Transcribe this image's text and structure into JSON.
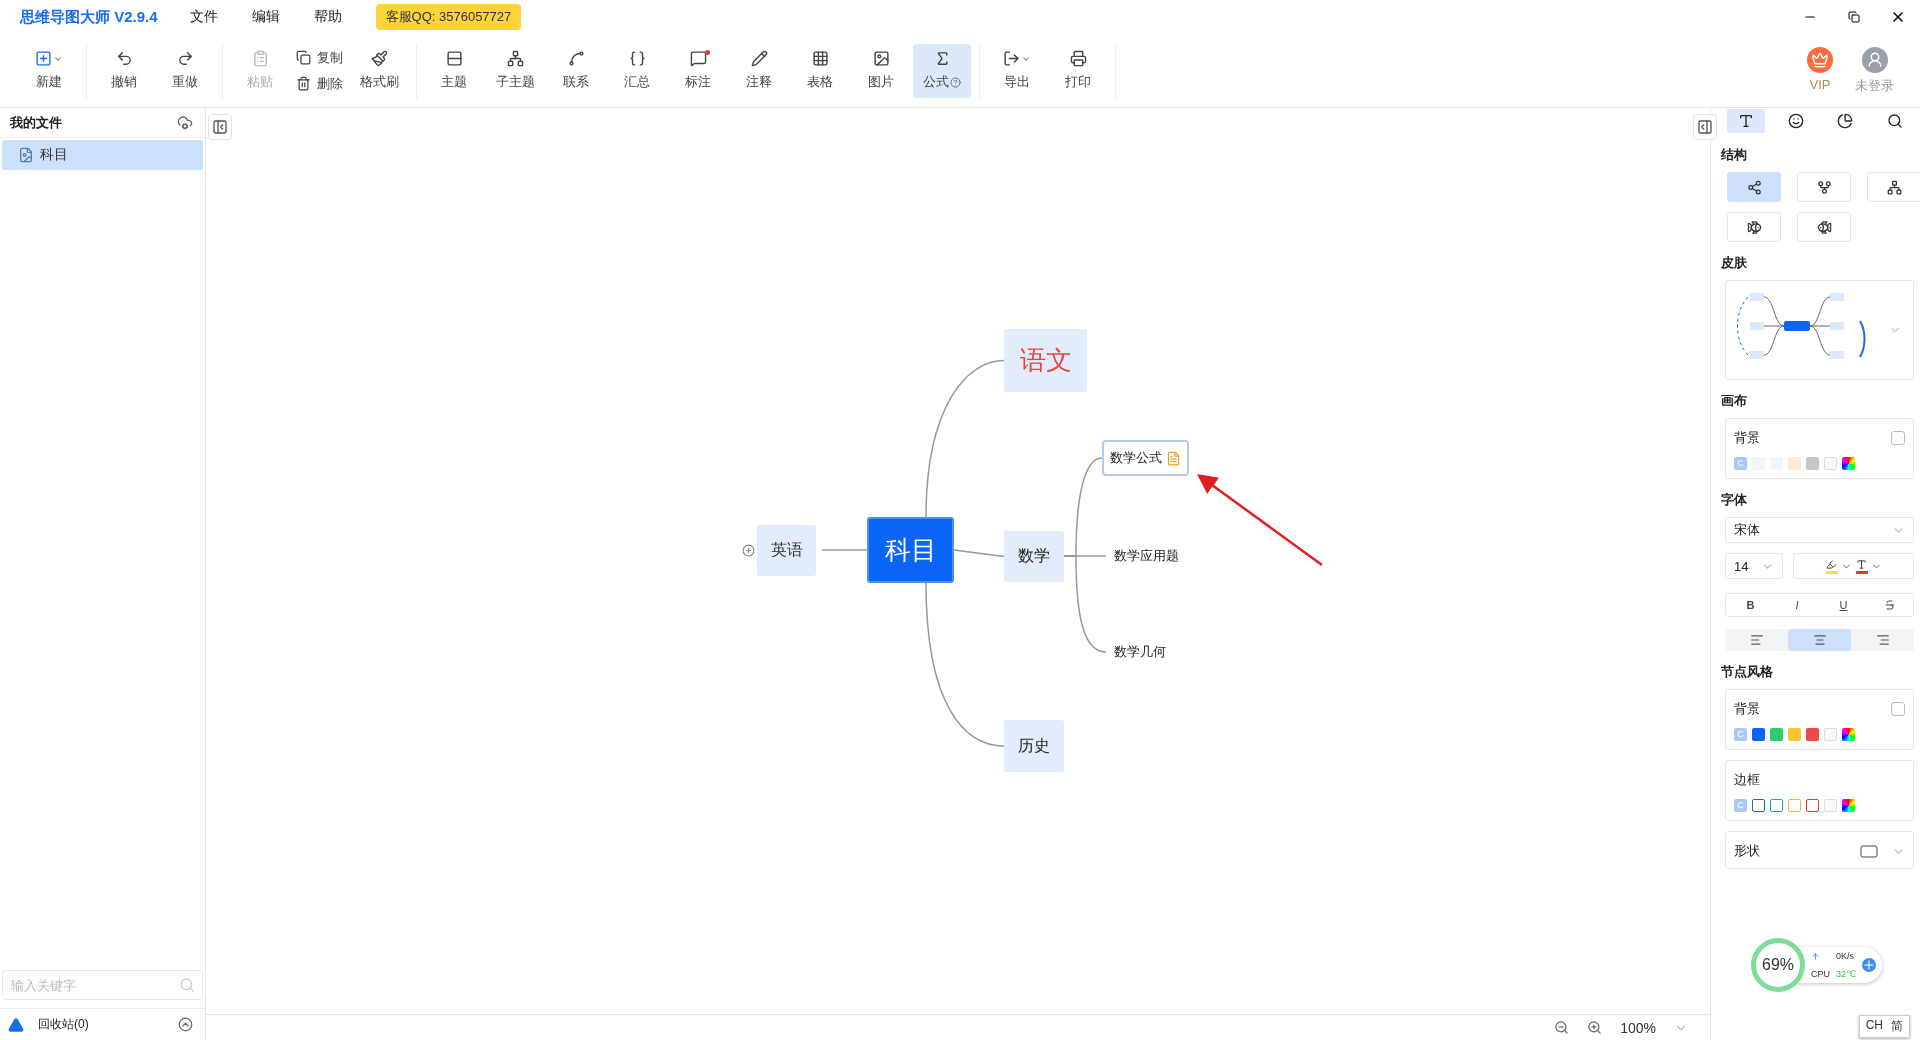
{
  "app": {
    "title": "思维导图大师 V2.9.4",
    "menus": [
      "文件",
      "编辑",
      "帮助"
    ],
    "support_badge": "客服QQ: 3576057727"
  },
  "toolbar": {
    "groups": [
      [
        {
          "label": "新建",
          "kind": "big",
          "dropdown": true,
          "disabled": false,
          "selected": false
        }
      ],
      [
        {
          "label": "撤销",
          "kind": "big",
          "disabled": false,
          "selected": false
        },
        {
          "label": "重做",
          "kind": "big",
          "disabled": false,
          "selected": false
        }
      ],
      [
        {
          "label": "粘贴",
          "kind": "big",
          "disabled": true,
          "selected": false
        },
        {
          "label": "复制",
          "kind": "small",
          "disabled": false,
          "selected": false
        },
        {
          "label": "删除",
          "kind": "small",
          "disabled": false,
          "selected": false
        },
        {
          "label": "格式刷",
          "kind": "big",
          "disabled": false,
          "selected": false
        }
      ],
      [
        {
          "label": "主题",
          "kind": "big",
          "disabled": false,
          "selected": false
        },
        {
          "label": "子主题",
          "kind": "big",
          "disabled": false,
          "selected": false
        },
        {
          "label": "联系",
          "kind": "big",
          "disabled": false,
          "selected": false
        },
        {
          "label": "汇总",
          "kind": "big",
          "disabled": false,
          "selected": false
        },
        {
          "label": "标注",
          "kind": "big",
          "dot": true,
          "disabled": false,
          "selected": false
        },
        {
          "label": "注释",
          "kind": "big",
          "disabled": false,
          "selected": false
        },
        {
          "label": "表格",
          "kind": "big",
          "disabled": false,
          "selected": false
        },
        {
          "label": "图片",
          "kind": "big",
          "disabled": false,
          "selected": false
        },
        {
          "label": "公式",
          "kind": "big",
          "help": true,
          "disabled": false,
          "selected": true
        }
      ],
      [
        {
          "label": "导出",
          "kind": "big",
          "dropdown": true,
          "disabled": false,
          "selected": false
        },
        {
          "label": "打印",
          "kind": "big",
          "disabled": false,
          "selected": false
        }
      ]
    ]
  },
  "account": {
    "vip": "VIP",
    "login": "未登录"
  },
  "sidebar": {
    "title": "我的文件",
    "files": [
      {
        "name": "科目",
        "selected": true
      }
    ],
    "search": {
      "placeholder": "输入关键字"
    },
    "trash": "回收站(0)"
  },
  "mindmap": {
    "root": "科目",
    "left": [
      {
        "text": "英语",
        "collapsed": true
      }
    ],
    "branches": [
      {
        "text": "语文",
        "color": "#e8453c"
      },
      {
        "text": "数学",
        "color": "#222222",
        "children": [
          {
            "text": "数学公式",
            "selected": true,
            "note": true
          },
          {
            "text": "数学应用题",
            "selected": false,
            "note": false
          },
          {
            "text": "数学几何",
            "selected": false,
            "note": false
          }
        ]
      },
      {
        "text": "历史",
        "color": "#222222"
      }
    ]
  },
  "status_bar": {
    "zoom": "100%"
  },
  "panel": {
    "tabs": [
      {
        "selected": true
      },
      {
        "selected": false
      },
      {
        "selected": false
      },
      {
        "selected": false
      }
    ],
    "structure": {
      "label": "结构",
      "options": [
        {
          "selected": true
        },
        {
          "selected": false
        },
        {
          "selected": false
        },
        {
          "selected": false
        },
        {
          "selected": false
        }
      ]
    },
    "skin": {
      "label": "皮肤"
    },
    "canvas": {
      "label": "画布",
      "background": {
        "label": "背景",
        "checked": false,
        "swatches": [
          {
            "kind": "custom",
            "label": "C"
          },
          {
            "kind": "fill",
            "color": "#f3f4f6"
          },
          {
            "kind": "fill",
            "color": "#f1f6f8"
          },
          {
            "kind": "fill",
            "color": "#fdebd3"
          },
          {
            "kind": "fill",
            "color": "#c6c6c6"
          },
          {
            "kind": "none"
          },
          {
            "kind": "picker"
          }
        ]
      }
    },
    "font": {
      "label": "字体",
      "family": "宋体",
      "size": "14",
      "color_buttons": [
        {
          "kind": "highlight",
          "color": "#f5d94a"
        },
        {
          "kind": "text",
          "color": "#e53935"
        }
      ],
      "styles": [
        {
          "kind": "bold",
          "label": "B"
        },
        {
          "kind": "italic",
          "label": "I"
        },
        {
          "kind": "underline",
          "label": "U"
        },
        {
          "kind": "strike"
        }
      ],
      "align": [
        {
          "selected": false
        },
        {
          "selected": true
        },
        {
          "selected": false
        }
      ]
    },
    "node_style": {
      "label": "节点风格",
      "background": {
        "label": "背景",
        "checked": false,
        "swatches": [
          {
            "kind": "custom",
            "label": "C"
          },
          {
            "kind": "fill",
            "color": "#0a64f5"
          },
          {
            "kind": "fill",
            "color": "#2ecc71"
          },
          {
            "kind": "fill",
            "color": "#fbc531"
          },
          {
            "kind": "fill",
            "color": "#f04848"
          },
          {
            "kind": "none"
          },
          {
            "kind": "picker"
          }
        ]
      },
      "border": {
        "label": "边框",
        "swatches": [
          {
            "kind": "custom",
            "label": "C"
          },
          {
            "kind": "outline",
            "color": "#1f5fd0"
          },
          {
            "kind": "outline",
            "color": "#20a5a5"
          },
          {
            "kind": "outline",
            "color": "#f5b82e"
          },
          {
            "kind": "outline",
            "color": "#e83a3a"
          },
          {
            "kind": "none"
          },
          {
            "kind": "picker"
          }
        ]
      },
      "shape": {
        "label": "形状"
      }
    }
  },
  "monitor": {
    "load": "69%",
    "net": "0K/s",
    "cpu_label": "CPU",
    "cpu_temp": "32℃"
  },
  "ime": {
    "lang": "CH",
    "mode": "简"
  }
}
